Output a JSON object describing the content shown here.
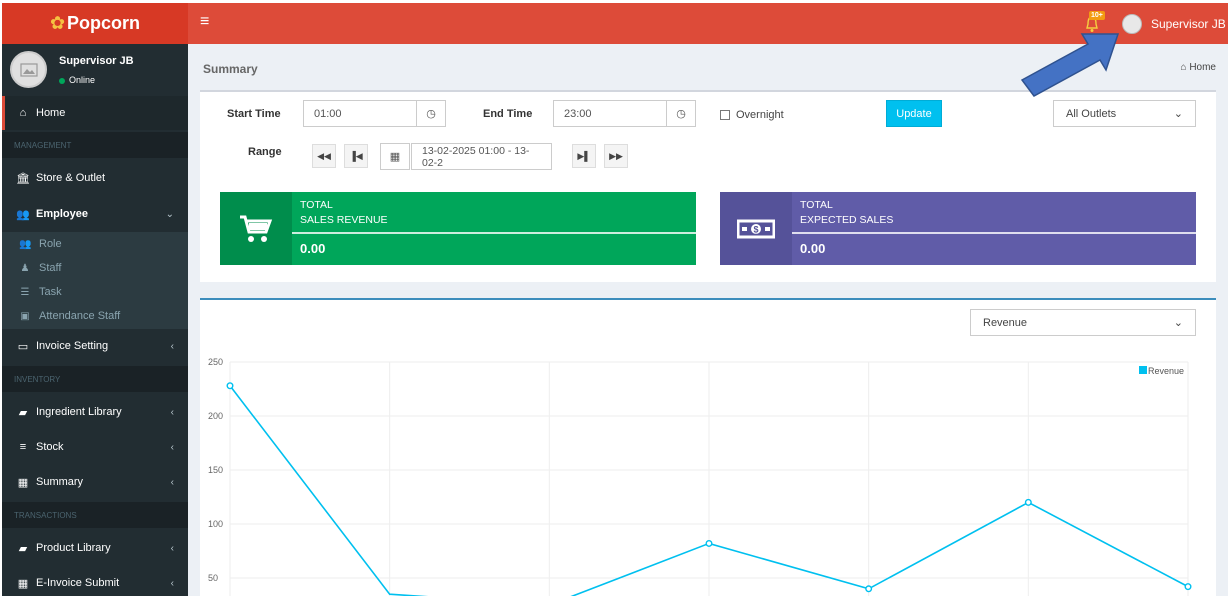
{
  "app": {
    "brand": "Popcorn"
  },
  "topbar": {
    "menu_icon": "hamburger-icon",
    "notif_badge": "10+",
    "user_name": "Supervisor JB"
  },
  "sidebar": {
    "user": {
      "name": "Supervisor JB",
      "status": "Online"
    },
    "home": "Home",
    "headers": {
      "management": "MANAGEMENT",
      "inventory": "INVENTORY",
      "transactions": "TRANSACTIONS"
    },
    "items": {
      "store_outlet": "Store & Outlet",
      "employee": "Employee",
      "role": "Role",
      "staff": "Staff",
      "task": "Task",
      "attendance": "Attendance Staff",
      "invoice_setting": "Invoice Setting",
      "ingredient_library": "Ingredient Library",
      "stock": "Stock",
      "summary": "Summary",
      "product_library": "Product Library",
      "einvoice": "E-Invoice Submit"
    }
  },
  "page": {
    "title": "Summary",
    "breadcrumb": "Home"
  },
  "filters": {
    "start_label": "Start Time",
    "start_value": "01:00",
    "end_label": "End Time",
    "end_value": "23:00",
    "overnight_label": "Overnight",
    "update_label": "Update",
    "outlet_selected": "All Outlets",
    "range_label": "Range",
    "range_value": "13-02-2025 01:00 - 13-02-2"
  },
  "cards": {
    "sales": {
      "line1": "TOTAL",
      "line2": "SALES REVENUE",
      "value": "0.00",
      "color": "#00a65a",
      "icon_color": "#008d4c"
    },
    "expected": {
      "line1": "TOTAL",
      "line2": "EXPECTED SALES",
      "value": "0.00",
      "color": "#605ca8",
      "icon_color": "#555299"
    }
  },
  "chart_select": "Revenue",
  "chart_data": {
    "type": "line",
    "x": [
      0,
      1,
      2,
      3,
      4,
      5,
      6
    ],
    "series": [
      {
        "name": "Revenue",
        "values": [
          228,
          35,
          25,
          82,
          40,
          120,
          42
        ],
        "color": "#00c0ef"
      }
    ],
    "yticks": [
      250,
      200,
      150,
      100,
      50
    ],
    "ylim": [
      40,
      250
    ],
    "legend": "top-right",
    "grid": true
  }
}
